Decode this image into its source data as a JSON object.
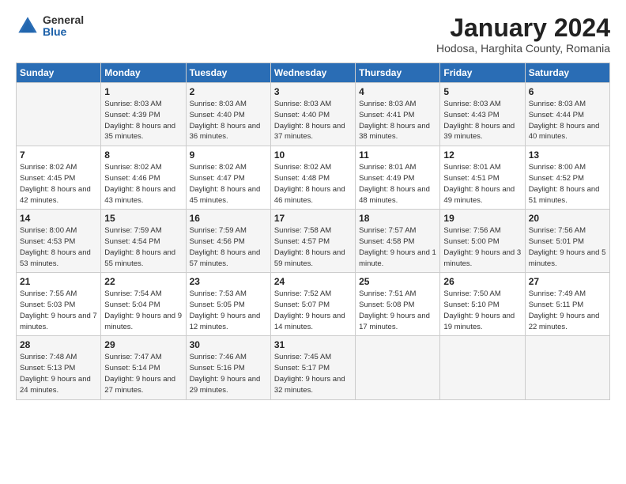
{
  "logo": {
    "general": "General",
    "blue": "Blue"
  },
  "title": "January 2024",
  "location": "Hodosa, Harghita County, Romania",
  "days_header": [
    "Sunday",
    "Monday",
    "Tuesday",
    "Wednesday",
    "Thursday",
    "Friday",
    "Saturday"
  ],
  "weeks": [
    [
      {
        "num": "",
        "sunrise": "",
        "sunset": "",
        "daylight": ""
      },
      {
        "num": "1",
        "sunrise": "Sunrise: 8:03 AM",
        "sunset": "Sunset: 4:39 PM",
        "daylight": "Daylight: 8 hours and 35 minutes."
      },
      {
        "num": "2",
        "sunrise": "Sunrise: 8:03 AM",
        "sunset": "Sunset: 4:40 PM",
        "daylight": "Daylight: 8 hours and 36 minutes."
      },
      {
        "num": "3",
        "sunrise": "Sunrise: 8:03 AM",
        "sunset": "Sunset: 4:40 PM",
        "daylight": "Daylight: 8 hours and 37 minutes."
      },
      {
        "num": "4",
        "sunrise": "Sunrise: 8:03 AM",
        "sunset": "Sunset: 4:41 PM",
        "daylight": "Daylight: 8 hours and 38 minutes."
      },
      {
        "num": "5",
        "sunrise": "Sunrise: 8:03 AM",
        "sunset": "Sunset: 4:43 PM",
        "daylight": "Daylight: 8 hours and 39 minutes."
      },
      {
        "num": "6",
        "sunrise": "Sunrise: 8:03 AM",
        "sunset": "Sunset: 4:44 PM",
        "daylight": "Daylight: 8 hours and 40 minutes."
      }
    ],
    [
      {
        "num": "7",
        "sunrise": "Sunrise: 8:02 AM",
        "sunset": "Sunset: 4:45 PM",
        "daylight": "Daylight: 8 hours and 42 minutes."
      },
      {
        "num": "8",
        "sunrise": "Sunrise: 8:02 AM",
        "sunset": "Sunset: 4:46 PM",
        "daylight": "Daylight: 8 hours and 43 minutes."
      },
      {
        "num": "9",
        "sunrise": "Sunrise: 8:02 AM",
        "sunset": "Sunset: 4:47 PM",
        "daylight": "Daylight: 8 hours and 45 minutes."
      },
      {
        "num": "10",
        "sunrise": "Sunrise: 8:02 AM",
        "sunset": "Sunset: 4:48 PM",
        "daylight": "Daylight: 8 hours and 46 minutes."
      },
      {
        "num": "11",
        "sunrise": "Sunrise: 8:01 AM",
        "sunset": "Sunset: 4:49 PM",
        "daylight": "Daylight: 8 hours and 48 minutes."
      },
      {
        "num": "12",
        "sunrise": "Sunrise: 8:01 AM",
        "sunset": "Sunset: 4:51 PM",
        "daylight": "Daylight: 8 hours and 49 minutes."
      },
      {
        "num": "13",
        "sunrise": "Sunrise: 8:00 AM",
        "sunset": "Sunset: 4:52 PM",
        "daylight": "Daylight: 8 hours and 51 minutes."
      }
    ],
    [
      {
        "num": "14",
        "sunrise": "Sunrise: 8:00 AM",
        "sunset": "Sunset: 4:53 PM",
        "daylight": "Daylight: 8 hours and 53 minutes."
      },
      {
        "num": "15",
        "sunrise": "Sunrise: 7:59 AM",
        "sunset": "Sunset: 4:54 PM",
        "daylight": "Daylight: 8 hours and 55 minutes."
      },
      {
        "num": "16",
        "sunrise": "Sunrise: 7:59 AM",
        "sunset": "Sunset: 4:56 PM",
        "daylight": "Daylight: 8 hours and 57 minutes."
      },
      {
        "num": "17",
        "sunrise": "Sunrise: 7:58 AM",
        "sunset": "Sunset: 4:57 PM",
        "daylight": "Daylight: 8 hours and 59 minutes."
      },
      {
        "num": "18",
        "sunrise": "Sunrise: 7:57 AM",
        "sunset": "Sunset: 4:58 PM",
        "daylight": "Daylight: 9 hours and 1 minute."
      },
      {
        "num": "19",
        "sunrise": "Sunrise: 7:56 AM",
        "sunset": "Sunset: 5:00 PM",
        "daylight": "Daylight: 9 hours and 3 minutes."
      },
      {
        "num": "20",
        "sunrise": "Sunrise: 7:56 AM",
        "sunset": "Sunset: 5:01 PM",
        "daylight": "Daylight: 9 hours and 5 minutes."
      }
    ],
    [
      {
        "num": "21",
        "sunrise": "Sunrise: 7:55 AM",
        "sunset": "Sunset: 5:03 PM",
        "daylight": "Daylight: 9 hours and 7 minutes."
      },
      {
        "num": "22",
        "sunrise": "Sunrise: 7:54 AM",
        "sunset": "Sunset: 5:04 PM",
        "daylight": "Daylight: 9 hours and 9 minutes."
      },
      {
        "num": "23",
        "sunrise": "Sunrise: 7:53 AM",
        "sunset": "Sunset: 5:05 PM",
        "daylight": "Daylight: 9 hours and 12 minutes."
      },
      {
        "num": "24",
        "sunrise": "Sunrise: 7:52 AM",
        "sunset": "Sunset: 5:07 PM",
        "daylight": "Daylight: 9 hours and 14 minutes."
      },
      {
        "num": "25",
        "sunrise": "Sunrise: 7:51 AM",
        "sunset": "Sunset: 5:08 PM",
        "daylight": "Daylight: 9 hours and 17 minutes."
      },
      {
        "num": "26",
        "sunrise": "Sunrise: 7:50 AM",
        "sunset": "Sunset: 5:10 PM",
        "daylight": "Daylight: 9 hours and 19 minutes."
      },
      {
        "num": "27",
        "sunrise": "Sunrise: 7:49 AM",
        "sunset": "Sunset: 5:11 PM",
        "daylight": "Daylight: 9 hours and 22 minutes."
      }
    ],
    [
      {
        "num": "28",
        "sunrise": "Sunrise: 7:48 AM",
        "sunset": "Sunset: 5:13 PM",
        "daylight": "Daylight: 9 hours and 24 minutes."
      },
      {
        "num": "29",
        "sunrise": "Sunrise: 7:47 AM",
        "sunset": "Sunset: 5:14 PM",
        "daylight": "Daylight: 9 hours and 27 minutes."
      },
      {
        "num": "30",
        "sunrise": "Sunrise: 7:46 AM",
        "sunset": "Sunset: 5:16 PM",
        "daylight": "Daylight: 9 hours and 29 minutes."
      },
      {
        "num": "31",
        "sunrise": "Sunrise: 7:45 AM",
        "sunset": "Sunset: 5:17 PM",
        "daylight": "Daylight: 9 hours and 32 minutes."
      },
      {
        "num": "",
        "sunrise": "",
        "sunset": "",
        "daylight": ""
      },
      {
        "num": "",
        "sunrise": "",
        "sunset": "",
        "daylight": ""
      },
      {
        "num": "",
        "sunrise": "",
        "sunset": "",
        "daylight": ""
      }
    ]
  ]
}
